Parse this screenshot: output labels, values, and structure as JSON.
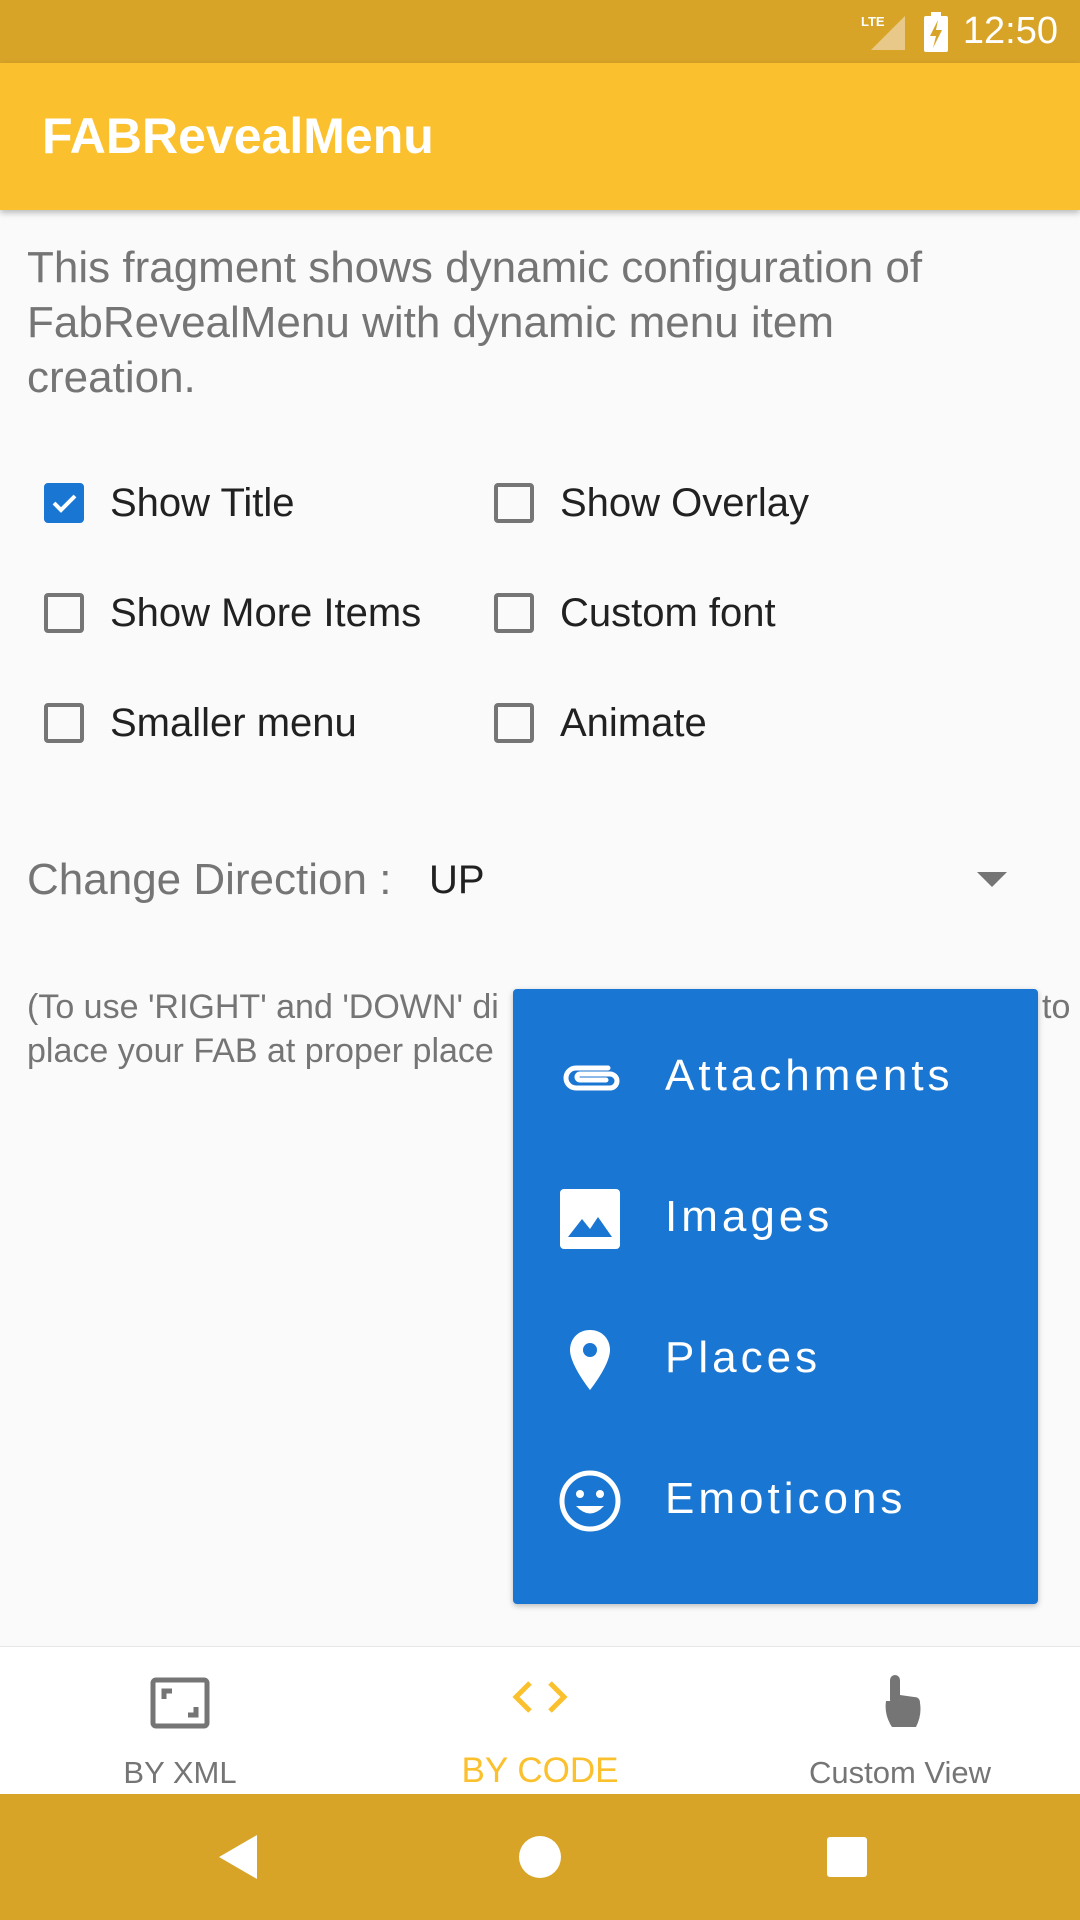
{
  "status_bar": {
    "time": "12:50",
    "network": "LTE",
    "background": "#D7A428"
  },
  "app_bar": {
    "title": "FABRevealMenu",
    "color": "#FBC02D"
  },
  "description": "This fragment shows dynamic configuration of FabRevealMenu with dynamic menu item creation.",
  "options": [
    {
      "label": "Show Title",
      "checked": true
    },
    {
      "label": "Show Overlay",
      "checked": false
    },
    {
      "label": "Show More Items",
      "checked": false
    },
    {
      "label": "Custom font",
      "checked": false
    },
    {
      "label": "Smaller menu",
      "checked": false
    },
    {
      "label": "Animate",
      "checked": false
    }
  ],
  "direction": {
    "label": "Change Direction :",
    "value": "UP"
  },
  "note": {
    "line1_start": "(To use 'RIGHT' and 'DOWN' di",
    "line1_end": "to",
    "line2": "place your FAB at proper place"
  },
  "reveal_menu": {
    "color": "#1976D2",
    "items": [
      {
        "label": "Attachments",
        "icon": "attachment-icon"
      },
      {
        "label": "Images",
        "icon": "image-icon"
      },
      {
        "label": "Places",
        "icon": "place-icon"
      },
      {
        "label": "Emoticons",
        "icon": "emoticon-icon"
      }
    ]
  },
  "bottom_nav": {
    "items": [
      {
        "label": "BY XML",
        "icon": "crop-free-icon",
        "active": false
      },
      {
        "label": "BY CODE",
        "icon": "code-icon",
        "active": true
      },
      {
        "label": "Custom View",
        "icon": "touch-icon",
        "active": false
      }
    ],
    "active_color": "#FBC02D"
  },
  "system_nav": {
    "buttons": [
      "back-icon",
      "home-icon",
      "recents-icon"
    ]
  }
}
